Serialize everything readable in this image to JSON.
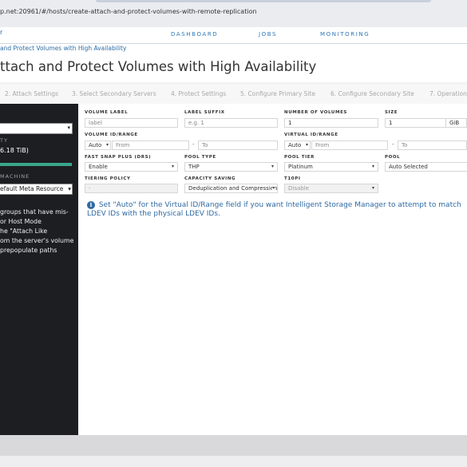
{
  "browser": {
    "url": "p.net:20961/#/hosts/create-attach-and-protect-volumes-with-remote-replication"
  },
  "topnav": {
    "logo_fragment": "r",
    "links": [
      "DASHBOARD",
      "JOBS",
      "MONITORING"
    ]
  },
  "breadcrumb": "and Protect Volumes with High Availability",
  "page_title": "ttach and Protect Volumes with High Availability",
  "steps": [
    "2. Attach Settings",
    "3. Select Secondary Servers",
    "4. Protect Settings",
    "5. Configure Primary Site",
    "6. Configure Secondary Site",
    "7. Operation"
  ],
  "sidebar": {
    "capacity_label": "TY",
    "capacity_value": "6.18 TiB)",
    "machine_label": "MACHINE",
    "machine_value": "efault Meta Resource",
    "help_text": "groups that have mis- or Host Mode he \"Attach Like om the server's volume prepopulate paths",
    "help_lines": [
      "groups that have mis-",
      "or Host Mode",
      "he \"Attach Like",
      "om the server's volume",
      "prepopulate paths"
    ]
  },
  "form": {
    "volume_label": {
      "label": "VOLUME LABEL",
      "placeholder": "label"
    },
    "label_suffix": {
      "label": "LABEL SUFFIX",
      "placeholder": "e.g. 1"
    },
    "number_of_volumes": {
      "label": "NUMBER OF VOLUMES",
      "value": "1"
    },
    "size": {
      "label": "SIZE",
      "value": "1",
      "unit": "GiB"
    },
    "volume_id_range": {
      "label": "VOLUME ID/RANGE",
      "mode": "Auto",
      "from_placeholder": "From",
      "to_placeholder": "To"
    },
    "virtual_id_range": {
      "label": "VIRTUAL ID/RANGE",
      "mode": "Auto",
      "from_placeholder": "From",
      "to_placeholder": "To"
    },
    "fast_snap_plus": {
      "label": "FAST SNAP PLUS (DRS)",
      "value": "Enable"
    },
    "pool_type": {
      "label": "POOL TYPE",
      "value": "THP"
    },
    "pool_tier": {
      "label": "POOL TIER",
      "value": "Platinum"
    },
    "pool": {
      "label": "POOL",
      "value": "Auto Selected"
    },
    "tiering_policy": {
      "label": "TIERING POLICY",
      "value": "-"
    },
    "capacity_saving": {
      "label": "CAPACITY SAVING",
      "value": "Deduplication and Compression"
    },
    "t10pi": {
      "label": "T10PI",
      "value": "Disable"
    }
  },
  "info_message": "Set \"Auto\" for the Virtual ID/Range field if you want Intelligent Storage Manager to attempt to match LDEV IDs with the physical LDEV IDs.",
  "colors": {
    "accent": "#2f6aa3",
    "sidebar_bg": "#1d1e21",
    "capacity_bar": "#3aa68c"
  }
}
